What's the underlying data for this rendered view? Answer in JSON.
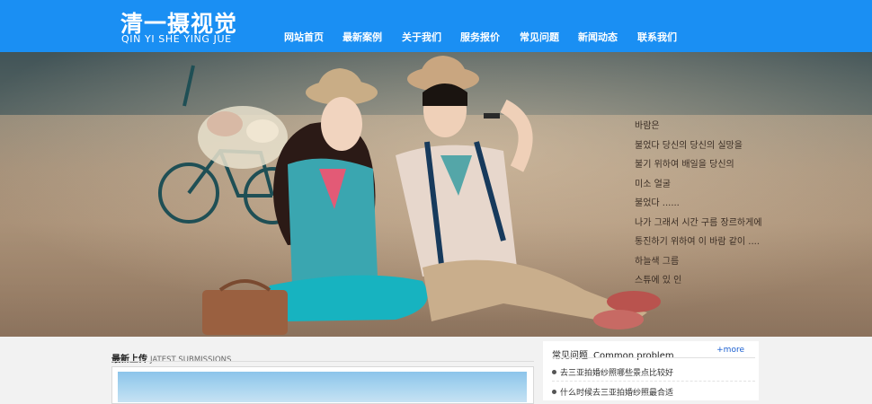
{
  "logo": {
    "title": "清一摄视觉",
    "subtitle": "QIN YI SHE YING JUE"
  },
  "nav": {
    "items": [
      "网站首页",
      "最新案例",
      "关于我们",
      "服务报价",
      "常见问题",
      "新闻动态",
      "联系我们"
    ]
  },
  "banner": {
    "poem": [
      "바람은",
      "불었다 당신의 당신의 실망을",
      "불기 위하여 배일을 당신의",
      "미소 얼굴",
      "불었다 ......",
      "나가 그래서 시간 구름 장르하게에",
      "통진하기 위하여 이 바람 같이 ....",
      "하늘색 그름",
      "스튜에 있 인"
    ]
  },
  "latest": {
    "title_cn": "最新上传",
    "title_en": "JATEST SUBMISSIONS"
  },
  "faq": {
    "title_cn": "常见问题",
    "title_en": "Common problem",
    "more": "+more",
    "items": [
      "去三亚拍婚纱照哪些景点比较好",
      "什么时候去三亚拍婚纱照最合适"
    ]
  },
  "colors": {
    "header": "#1a8ff3",
    "accent_link": "#1a5fd0"
  }
}
